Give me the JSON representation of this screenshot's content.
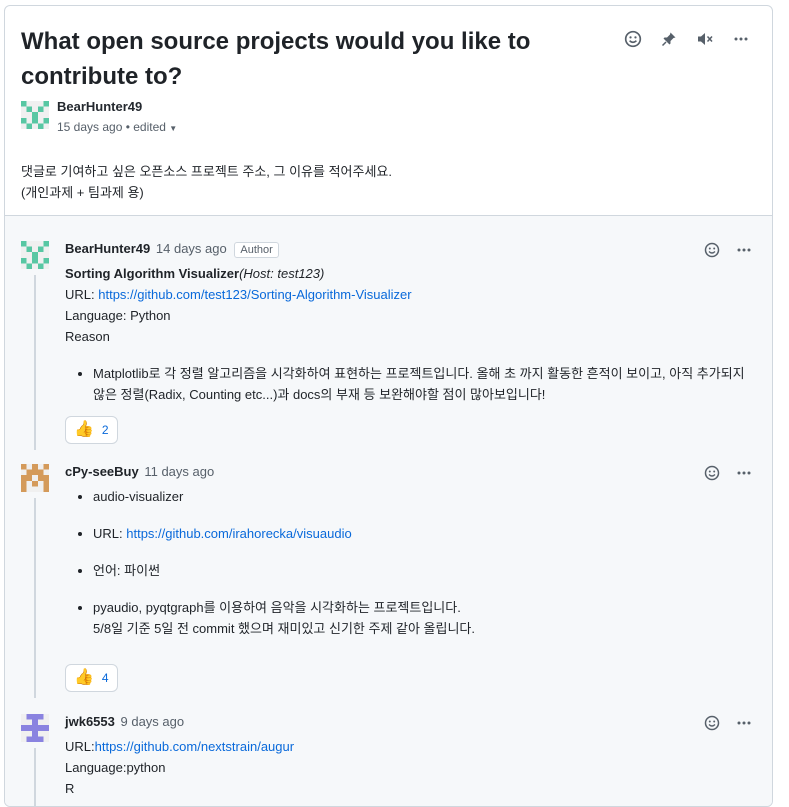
{
  "discussion": {
    "title": "What open source projects would you like to contribute to?",
    "author": "BearHunter49",
    "meta": "15 days ago • edited",
    "body_line1": "댓글로 기여하고 싶은 오픈소스 프로젝트 주소, 그 이유를 적어주세요.",
    "body_line2": "(개인과제 + 팀과제 용)",
    "icons": [
      "smiley-icon",
      "pin-icon",
      "mute-icon",
      "more-icon"
    ]
  },
  "comments": [
    {
      "author": "BearHunter49",
      "time": "14 days ago",
      "badge": "Author",
      "project_title": "Sorting Algorithm Visualizer",
      "project_host": "(Host: test123)",
      "url_label": "URL: ",
      "url": "https://github.com/test123/Sorting-Algorithm-Visualizer",
      "language": "Language: Python",
      "reason_label": "Reason",
      "reason": "Matplotlib로 각 정렬 알고리즘을 시각화하여 표현하는 프로젝트입니다. 올해 초 까지 활동한 흔적이 보이고, 아직 추가되지 않은 정렬(Radix, Counting etc...)과 docs의 부재 등 보완해야할 점이 많아보입니다!",
      "reaction_count": "2",
      "avatar_color": "#58c7a3"
    },
    {
      "author": "cPy-seeBuy",
      "time": "11 days ago",
      "item1": "audio-visualizer",
      "url_label": "URL: ",
      "url": "https://github.com/irahorecka/visuaudio",
      "lang": "언어: 파이썬",
      "desc1": "pyaudio, pyqtgraph를 이용하여 음악을 시각화하는 프로젝트입니다.",
      "desc2": "5/8일 기준 5일 전 commit 했으며 재미있고 신기한 주제 같아 올립니다.",
      "reaction_count": "4",
      "avatar_color": "#d49a5a"
    },
    {
      "author": "jwk6553",
      "time": "9 days ago",
      "url_label": "URL:",
      "url": "https://github.com/nextstrain/augur",
      "language": "Language:python",
      "reason_partial": "R",
      "avatar_color": "#8a83e0"
    }
  ]
}
